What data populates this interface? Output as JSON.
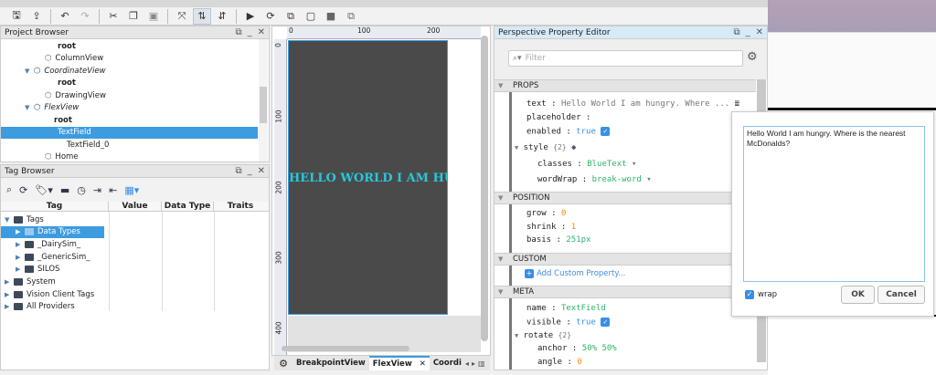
{
  "toolbar": {
    "icons": [
      "save-icon",
      "publish-icon",
      "undo-icon",
      "redo-icon",
      "cut-icon",
      "copy-icon",
      "paste-icon",
      "disconnect-icon",
      "flex-direction-column-icon",
      "flex-direction-row-icon",
      "play-icon",
      "refresh-icon",
      "layer-icon",
      "layer-front-icon",
      "layer-back-icon",
      "layer-group-icon"
    ]
  },
  "project_browser": {
    "title": "Project Browser",
    "items": [
      {
        "label": "root",
        "bold": true
      },
      {
        "label": "ColumnView"
      },
      {
        "label": "CoordinateView",
        "italic": true
      },
      {
        "label": "root",
        "bold": true
      },
      {
        "label": "DrawingView"
      },
      {
        "label": "FlexView",
        "italic": true
      },
      {
        "label": "root",
        "bold": true
      },
      {
        "label": "TextField",
        "selected": true
      },
      {
        "label": "TextField_0"
      },
      {
        "label": "Home"
      }
    ]
  },
  "tag_browser": {
    "title": "Tag Browser",
    "columns": [
      "Tag",
      "Value",
      "Data Type",
      "Traits"
    ],
    "rows": [
      "Tags",
      "Data Types",
      "_DairySim_",
      "_GenericSim_",
      "SILOS",
      "System",
      "Vision Client Tags",
      "All Providers"
    ]
  },
  "canvas": {
    "ruler_top": [
      "0",
      "100",
      "200"
    ],
    "ruler_left": [
      "0",
      "100",
      "200",
      "300",
      "400"
    ],
    "text": "HELLO WORLD I AM HUN",
    "bg_color": "#4a4a4a",
    "text_color": "#29c7dc"
  },
  "tabs": {
    "items": [
      "BreakpointView",
      "FlexView",
      "Coordi"
    ],
    "active": "FlexView"
  },
  "property_editor": {
    "title": "Perspective Property Editor",
    "filter_placeholder": "Filter",
    "sections": {
      "props": "PROPS",
      "position": "POSITION",
      "custom": "CUSTOM",
      "meta": "META"
    },
    "props": {
      "text_key": "text",
      "text_val": "Hello World I am hungry.  Where ...",
      "placeholder_key": "placeholder",
      "enabled_key": "enabled",
      "enabled_val": "true",
      "style_key": "style",
      "style_count": "{2}",
      "classes_key": "classes",
      "classes_val": "BlueText",
      "wordwrap_key": "wordWrap",
      "wordwrap_val": "break-word"
    },
    "position": {
      "grow_key": "grow",
      "grow_val": "0",
      "shrink_key": "shrink",
      "shrink_val": "1",
      "basis_key": "basis",
      "basis_val": "251px"
    },
    "custom": {
      "add_label": "Add Custom Property..."
    },
    "meta": {
      "name_key": "name",
      "name_val": "TextField",
      "visible_key": "visible",
      "visible_val": "true",
      "rotate_key": "rotate",
      "rotate_count": "{2}",
      "anchor_key": "anchor",
      "anchor_val": "50% 50%",
      "angle_key": "angle",
      "angle_val": "0"
    }
  },
  "text_dialog": {
    "value": "Hello World I am hungry.  Where is the nearest McDonalds?",
    "wrap_label": "wrap",
    "ok": "OK",
    "cancel": "Cancel"
  },
  "colors": {
    "accent": "#3d9be0",
    "green": "#2fb36b",
    "orange": "#f08c1a"
  }
}
